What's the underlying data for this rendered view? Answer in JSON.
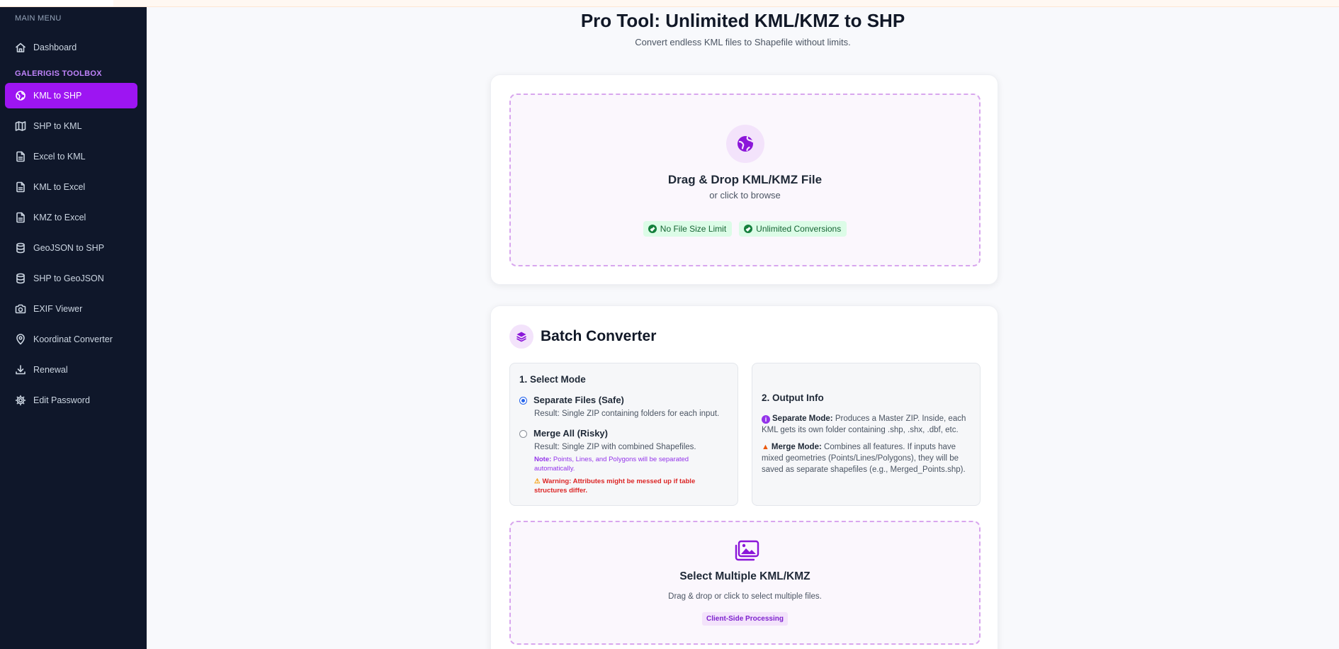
{
  "sidebar": {
    "main_menu_label": "MAIN MENU",
    "toolbox_label": "GALERIGIS TOOLBOX",
    "items": [
      {
        "label": "Dashboard",
        "icon": "home-icon"
      },
      {
        "label": "KML to SHP",
        "icon": "globe-icon",
        "active": true
      },
      {
        "label": "SHP to KML",
        "icon": "map-icon"
      },
      {
        "label": "Excel to KML",
        "icon": "file-icon"
      },
      {
        "label": "KML to Excel",
        "icon": "file-icon"
      },
      {
        "label": "KMZ to Excel",
        "icon": "file-icon"
      },
      {
        "label": "GeoJSON to SHP",
        "icon": "database-icon"
      },
      {
        "label": "SHP to GeoJSON",
        "icon": "database-icon"
      },
      {
        "label": "EXIF Viewer",
        "icon": "camera-icon"
      },
      {
        "label": "Koordinat Converter",
        "icon": "map-pin-icon"
      },
      {
        "label": "Renewal",
        "icon": "download-icon"
      },
      {
        "label": "Edit Password",
        "icon": "gear-icon"
      }
    ]
  },
  "header": {
    "title": "Pro Tool: Unlimited KML/KMZ to SHP",
    "subtitle": "Convert endless KML files to Shapefile without limits."
  },
  "upload": {
    "title": "Drag & Drop KML/KMZ File",
    "subtitle": "or click to browse",
    "badges": [
      "No File Size Limit",
      "Unlimited Conversions"
    ]
  },
  "batch": {
    "title": "Batch Converter",
    "mode": {
      "heading": "1. Select Mode",
      "options": [
        {
          "label": "Separate Files (Safe)",
          "desc": "Result: Single ZIP containing folders for each input.",
          "checked": true
        },
        {
          "label": "Merge All (Risky)",
          "desc": "Result: Single ZIP with combined Shapefiles.",
          "checked": false
        }
      ],
      "note_label": "Note:",
      "note_text": " Points, Lines, and Polygons will be separated automatically.",
      "warning": "Warning: Attributes might be messed up if table structures differ."
    },
    "info": {
      "heading": "2. Output Info",
      "separate_label": "Separate Mode:",
      "separate_text": " Produces a Master ZIP. Inside, each KML gets its own folder containing .shp, .shx, .dbf, etc.",
      "merge_label": "Merge Mode:",
      "merge_text": " Combines all features. If inputs have mixed geometries (Points/Lines/Polygons), they will be saved as separate shapefiles (e.g., Merged_Points.shp)."
    },
    "multi": {
      "title": "Select Multiple KML/KMZ",
      "subtitle": "Drag & drop or click to select multiple files.",
      "badge": "Client-Side Processing"
    }
  },
  "colors": {
    "accent": "#9d15f2",
    "sidebar_bg": "#0f172a",
    "dropzone_border": "#d8a6ee"
  }
}
